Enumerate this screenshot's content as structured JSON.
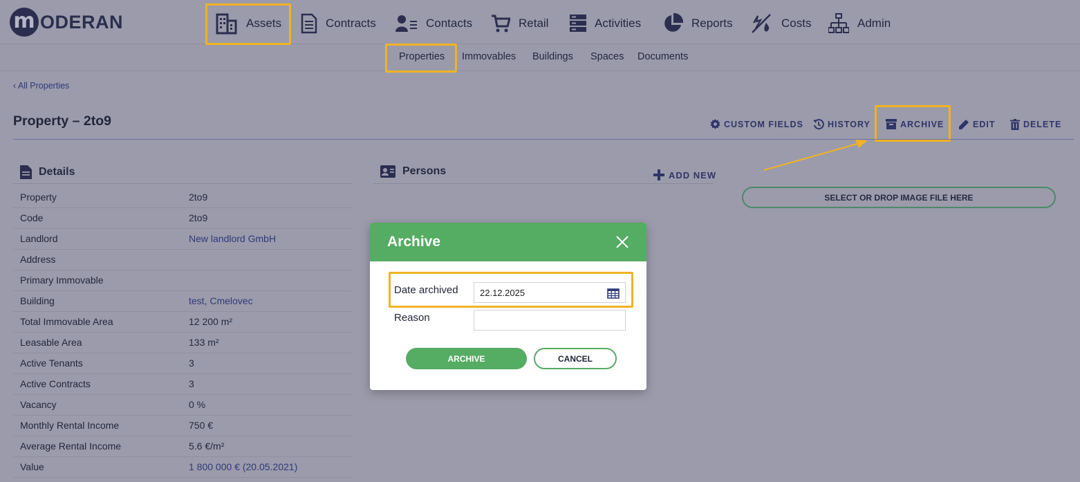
{
  "app": {
    "logo_mark": "m",
    "logo_text": "ODERAN"
  },
  "main_nav": [
    {
      "label": "Assets",
      "icon": "building-icon",
      "active": true
    },
    {
      "label": "Contracts",
      "icon": "document-icon"
    },
    {
      "label": "Contacts",
      "icon": "contacts-icon"
    },
    {
      "label": "Retail",
      "icon": "cart-icon"
    },
    {
      "label": "Activities",
      "icon": "server-icon"
    },
    {
      "label": "Reports",
      "icon": "pie-chart-icon"
    },
    {
      "label": "Costs",
      "icon": "costs-icon"
    },
    {
      "label": "Admin",
      "icon": "sitemap-icon"
    }
  ],
  "sub_nav": [
    {
      "label": "Properties",
      "active": true
    },
    {
      "label": "Immovables"
    },
    {
      "label": "Buildings"
    },
    {
      "label": "Spaces"
    },
    {
      "label": "Documents"
    }
  ],
  "breadcrumb": "‹ All Properties",
  "page_title": "Property – 2to9",
  "actions": {
    "custom_fields": "CUSTOM FIELDS",
    "history": "HISTORY",
    "archive": "ARCHIVE",
    "edit": "EDIT",
    "delete": "DELETE"
  },
  "details": {
    "title": "Details",
    "rows": [
      {
        "label": "Property",
        "value": "2to9"
      },
      {
        "label": "Code",
        "value": "2to9"
      },
      {
        "label": "Landlord",
        "value": "New landlord GmbH"
      },
      {
        "label": "Address",
        "value": ""
      },
      {
        "label": "Primary Immovable",
        "value": ""
      },
      {
        "label": "Building",
        "value": "test, Cmelovec"
      },
      {
        "label": "Total Immovable Area",
        "value": "12 200 m²"
      },
      {
        "label": "Leasable Area",
        "value": "133 m²"
      },
      {
        "label": "Active Tenants",
        "value": "3"
      },
      {
        "label": "Active Contracts",
        "value": "3"
      },
      {
        "label": "Vacancy",
        "value": "0 %"
      },
      {
        "label": "Monthly Rental Income",
        "value": "750 €"
      },
      {
        "label": "Average Rental Income",
        "value": "5.6 €/m²"
      },
      {
        "label": "Value",
        "value": "1 800 000 € (20.05.2021)"
      }
    ]
  },
  "persons": {
    "title": "Persons",
    "add_new": "ADD NEW"
  },
  "image_dropzone": "SELECT OR DROP IMAGE FILE HERE",
  "modal": {
    "title": "Archive",
    "date_label": "Date archived",
    "date_value": "22.12.2025",
    "reason_label": "Reason",
    "reason_value": "",
    "archive_button": "ARCHIVE",
    "cancel_button": "CANCEL"
  },
  "colors": {
    "overlay_background": "#9b9bab",
    "modal_green": "#55ac63",
    "highlight": "#f0b323",
    "link": "#2f3a7a"
  }
}
